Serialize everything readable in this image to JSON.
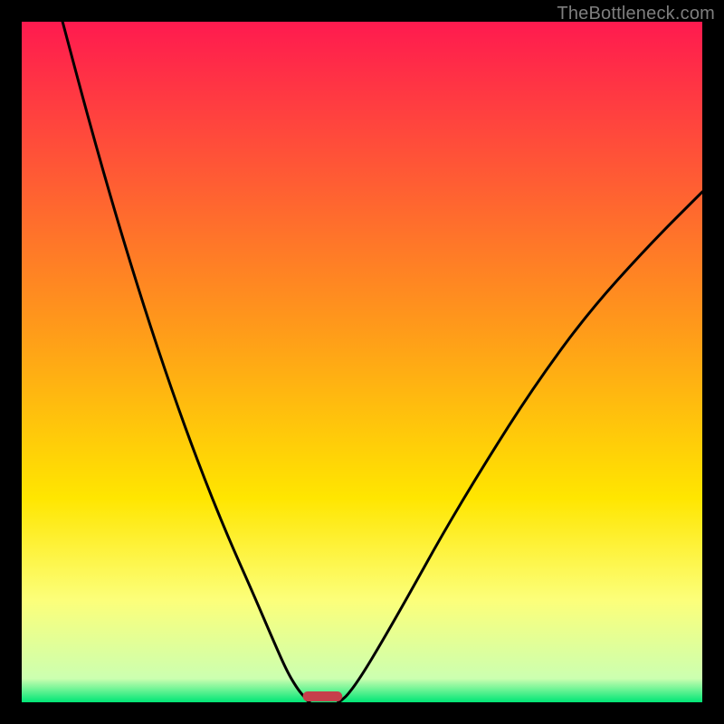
{
  "watermark": "TheBottleneck.com",
  "chart_data": {
    "type": "line",
    "title": "",
    "xlabel": "",
    "ylabel": "",
    "xlim": [
      0,
      100
    ],
    "ylim": [
      0,
      100
    ],
    "grid": false,
    "legend": false,
    "background_gradient": [
      {
        "pos": 0.0,
        "color": "#ff1a4f"
      },
      {
        "pos": 0.45,
        "color": "#ff9a1a"
      },
      {
        "pos": 0.7,
        "color": "#ffe600"
      },
      {
        "pos": 0.85,
        "color": "#fcff7a"
      },
      {
        "pos": 0.965,
        "color": "#ccffb0"
      },
      {
        "pos": 1.0,
        "color": "#00e676"
      }
    ],
    "series": [
      {
        "name": "left-curve",
        "x": [
          6,
          10,
          14,
          18,
          22,
          26,
          30,
          34,
          37,
          39,
          40.5,
          41.5,
          42,
          42.3
        ],
        "y": [
          100,
          85,
          71,
          58,
          46,
          35,
          25,
          16,
          9,
          4.5,
          2,
          0.8,
          0.2,
          0
        ]
      },
      {
        "name": "right-curve",
        "x": [
          46.5,
          47,
          48,
          50,
          53,
          57,
          62,
          68,
          75,
          83,
          92,
          100
        ],
        "y": [
          0,
          0.3,
          1.2,
          4,
          9,
          16,
          25,
          35,
          46,
          57,
          67,
          75
        ]
      }
    ],
    "marker": {
      "name": "base-marker",
      "x_center": 44.2,
      "width": 5.8,
      "y": 0,
      "color": "#c63f4b"
    }
  }
}
